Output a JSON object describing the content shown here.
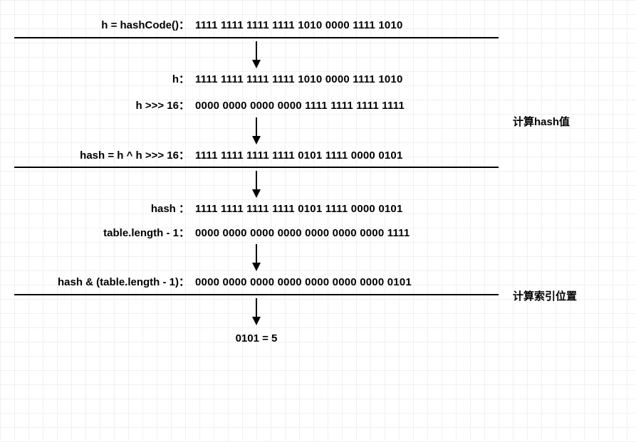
{
  "step1": {
    "label": "h = hashCode()：",
    "bits": "1111 1111 1111 1111 1010 0000 1111 1010"
  },
  "step2a": {
    "label": "h：",
    "bits": "1111 1111 1111 1111 1010 0000 1111 1010"
  },
  "step2b": {
    "label": "h >>> 16：",
    "bits": "0000 0000 0000 0000 1111 1111 1111 1111"
  },
  "step3": {
    "label": "hash = h ^ h >>> 16：",
    "bits": "1111 1111 1111 1111 0101 1111 0000 0101"
  },
  "step4a": {
    "label": "hash ：",
    "bits": "1111 1111 1111 1111 0101 1111 0000 0101"
  },
  "step4b": {
    "label": "table.length - 1：",
    "bits": "0000 0000 0000 0000 0000 0000 0000 1111"
  },
  "step5": {
    "label": "hash & (table.length - 1)：",
    "bits": "0000 0000 0000 0000 0000 0000 0000 0101"
  },
  "result": "0101 = 5",
  "annotations": {
    "hash": "计算hash值",
    "index": "计算索引位置"
  }
}
